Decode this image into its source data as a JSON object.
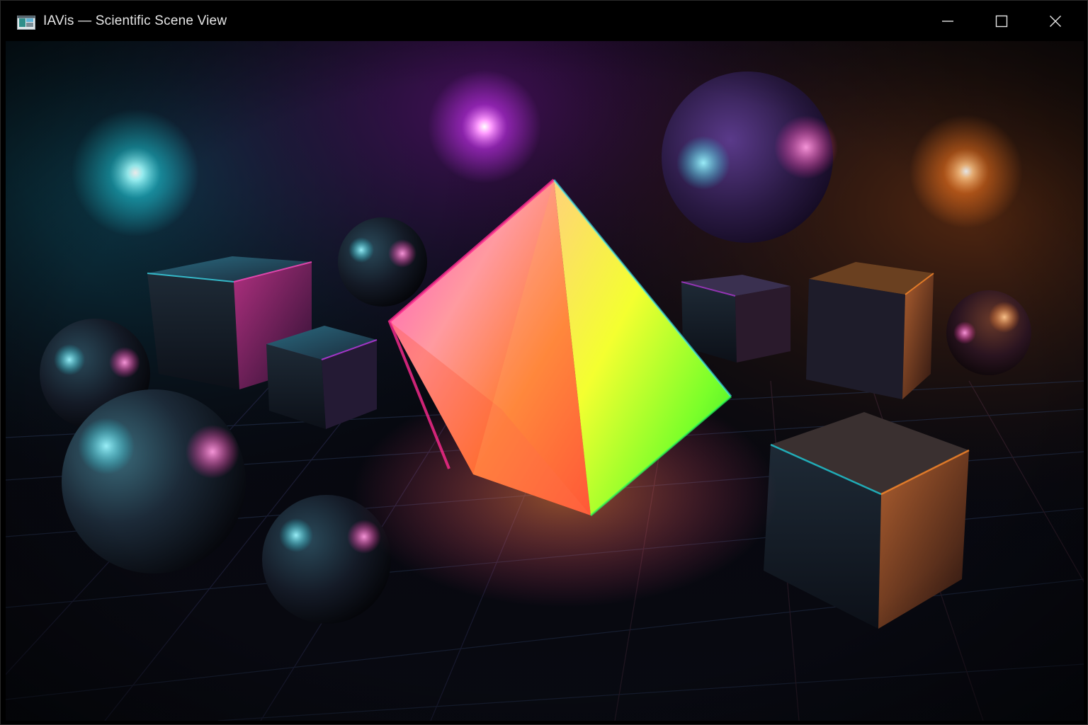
{
  "window": {
    "title": "IAVis — Scientific Scene View",
    "icon": "app-window-icon",
    "controls": {
      "minimize": "minimize-icon",
      "maximize": "maximize-icon",
      "close": "close-icon"
    }
  },
  "scene": {
    "background": "#07080f",
    "colors": {
      "cyan": "#1ee3f0",
      "magenta": "#d83cff",
      "pink": "#ff3aa8",
      "orange": "#ff8a2a",
      "yellow": "#f2ff2a",
      "green": "#32e62a"
    }
  }
}
